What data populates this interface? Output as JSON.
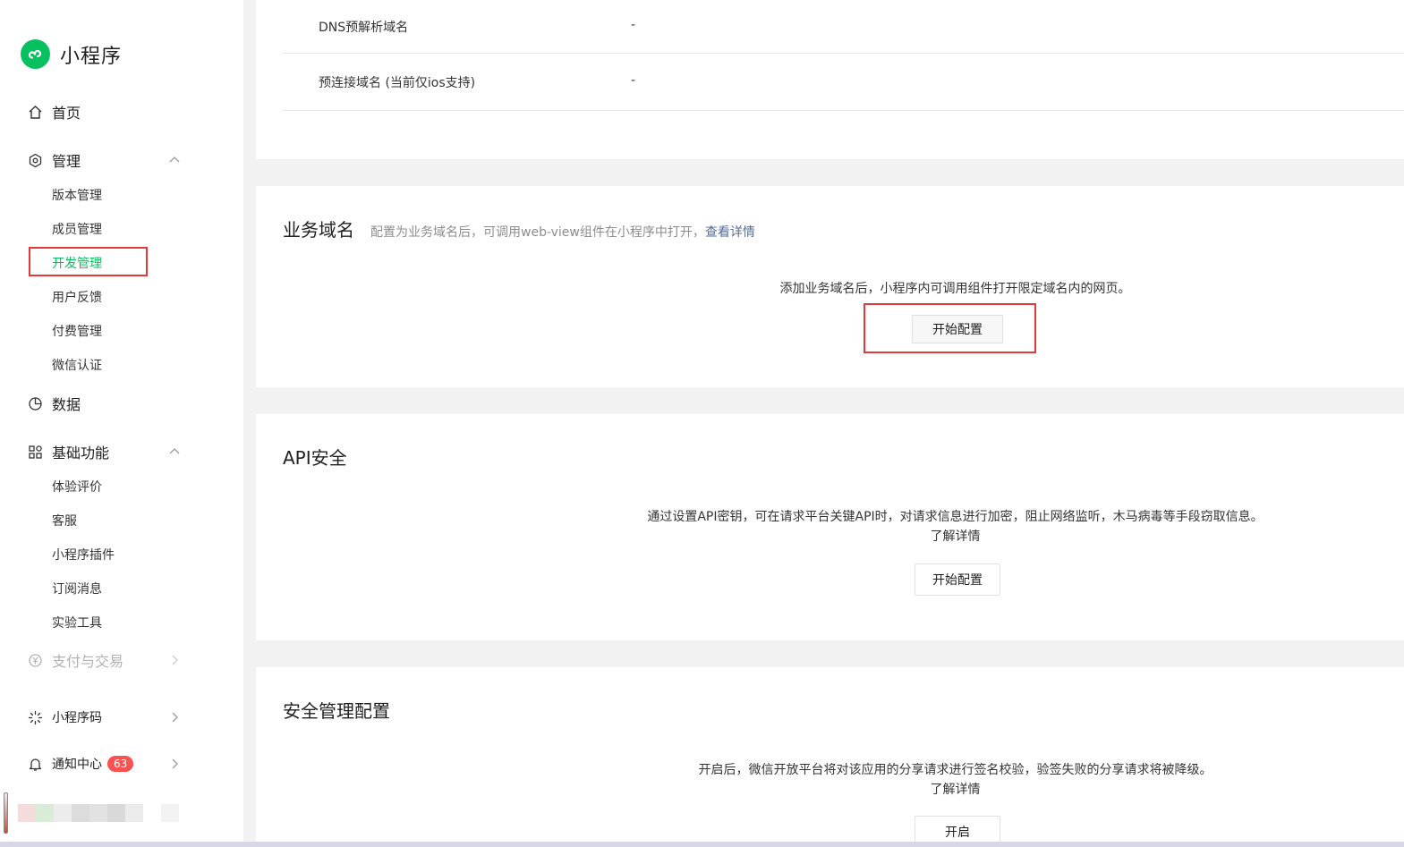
{
  "app": {
    "title": "小程序"
  },
  "sidebar": {
    "home": "首页",
    "manage": {
      "label": "管理",
      "items": [
        "版本管理",
        "成员管理",
        "开发管理",
        "用户反馈",
        "付费管理",
        "微信认证"
      ]
    },
    "data": "数据",
    "basic": {
      "label": "基础功能",
      "items": [
        "体验评价",
        "客服",
        "小程序插件",
        "订阅消息",
        "实验工具"
      ]
    },
    "payment": "支付与交易",
    "qrcode": "小程序码",
    "notification": {
      "label": "通知中心",
      "count": "63"
    }
  },
  "server_domains": {
    "rows": [
      {
        "label": "DNS预解析域名",
        "value": "-"
      },
      {
        "label": "预连接域名 (当前仅ios支持)",
        "value": "-"
      }
    ]
  },
  "business_domain": {
    "title": "业务域名",
    "subtitle": "配置为业务域名后，可调用web-view组件在小程序中打开，",
    "subtitle_link": "查看详情",
    "desc": "添加业务域名后，小程序内可调用组件打开限定域名内的网页。",
    "button": "开始配置"
  },
  "api_security": {
    "title": "API安全",
    "desc": "通过设置API密钥，可在请求平台关键API时，对请求信息进行加密，阻止网络监听，木马病毒等手段窃取信息。",
    "link": "了解详情",
    "button": "开始配置"
  },
  "security_config": {
    "title": "安全管理配置",
    "desc": "开启后，微信开放平台将对该应用的分享请求进行签名校验，验签失败的分享请求将被降级。",
    "link": "了解详情",
    "button": "开启"
  },
  "colors": {
    "brand": "#07c160",
    "highlight": "#e5383b",
    "link": "#576b95",
    "badge": "#fa5151"
  }
}
